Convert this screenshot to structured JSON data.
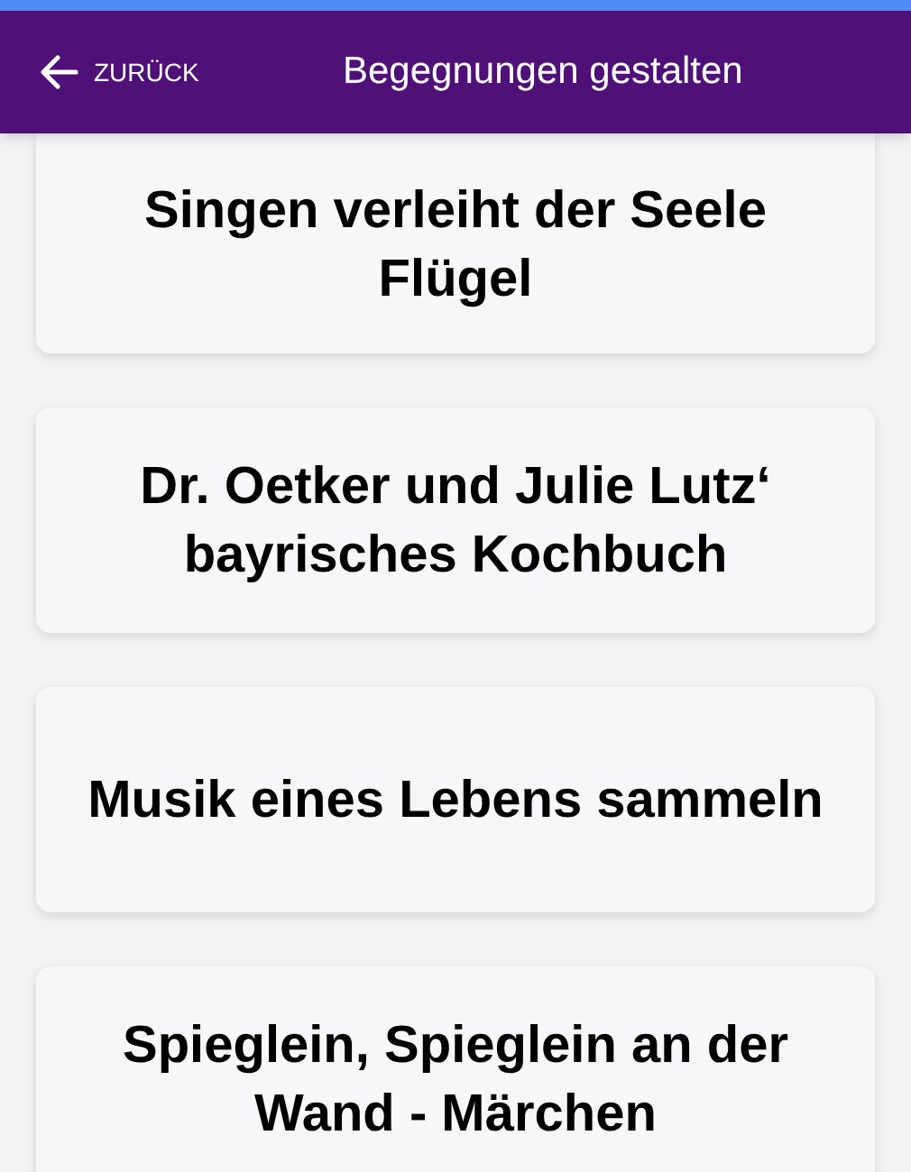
{
  "header": {
    "back_label": "ZURÜCK",
    "title": "Begegnungen gestalten"
  },
  "cards": [
    {
      "title": "Singen verleiht der Seele Flügel"
    },
    {
      "title": "Dr. Oetker und Julie Lutz‘ bayrisches Kochbuch"
    },
    {
      "title": "Musik eines Lebens sammeln"
    },
    {
      "title": "Spieglein, Spieglein an der Wand - Märchen"
    }
  ]
}
